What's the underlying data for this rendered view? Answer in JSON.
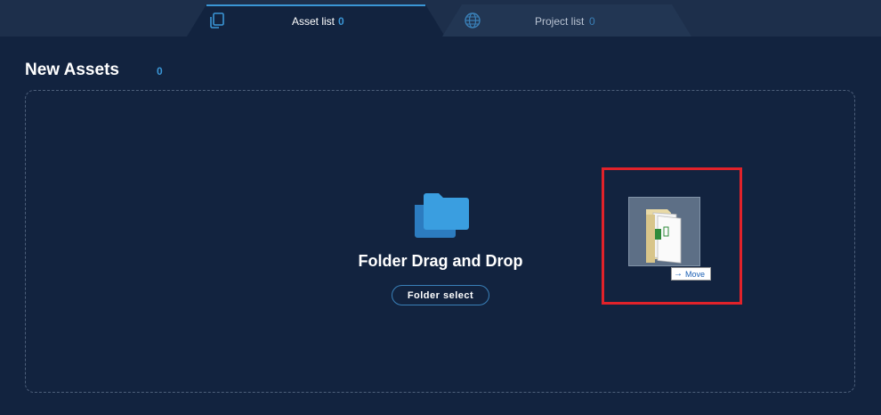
{
  "tabs": [
    {
      "label": "Asset list",
      "count": "0",
      "icon": "copy-icon",
      "active": true
    },
    {
      "label": "Project list",
      "count": "0",
      "icon": "globe-icon",
      "active": false
    }
  ],
  "section": {
    "title": "New Assets",
    "count": "0"
  },
  "dropzone": {
    "icon": "folders-icon",
    "title": "Folder Drag and Drop",
    "button_label": "Folder select"
  },
  "drag_overlay": {
    "icon": "dragged-folder-icon",
    "tooltip": "Move",
    "tooltip_icon": "arrow-right-icon"
  },
  "colors": {
    "background": "#12233f",
    "topbar": "#1d2f4b",
    "accent": "#3a96d6",
    "highlight": "#e1222a"
  }
}
